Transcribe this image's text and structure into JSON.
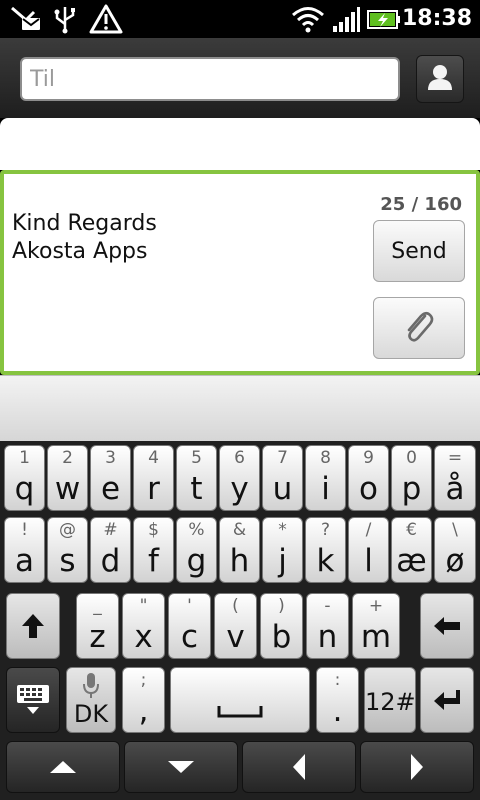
{
  "status_bar": {
    "time": "18:38",
    "icons": [
      "missed-sms-icon",
      "usb-icon",
      "warning-icon",
      "wifi-icon",
      "signal-icon",
      "battery-charging-icon"
    ]
  },
  "recipient": {
    "placeholder": "Til",
    "contact_button_icon": "contact-icon"
  },
  "compose": {
    "message": "Kind Regards\nAkosta Apps",
    "char_counter": "25 / 160",
    "send_label": "Send",
    "attach_icon": "paperclip-icon",
    "accent_color": "#86c440"
  },
  "keyboard": {
    "row1": [
      {
        "hint": "1",
        "main": "q"
      },
      {
        "hint": "2",
        "main": "w"
      },
      {
        "hint": "3",
        "main": "e"
      },
      {
        "hint": "4",
        "main": "r"
      },
      {
        "hint": "5",
        "main": "t"
      },
      {
        "hint": "6",
        "main": "y"
      },
      {
        "hint": "7",
        "main": "u"
      },
      {
        "hint": "8",
        "main": "i"
      },
      {
        "hint": "9",
        "main": "o"
      },
      {
        "hint": "0",
        "main": "p"
      },
      {
        "hint": "=",
        "main": "å"
      }
    ],
    "row2": [
      {
        "hint": "!",
        "main": "a"
      },
      {
        "hint": "@",
        "main": "s"
      },
      {
        "hint": "#",
        "main": "d"
      },
      {
        "hint": "$",
        "main": "f"
      },
      {
        "hint": "%",
        "main": "g"
      },
      {
        "hint": "&",
        "main": "h"
      },
      {
        "hint": "*",
        "main": "j"
      },
      {
        "hint": "?",
        "main": "k"
      },
      {
        "hint": "/",
        "main": "l"
      },
      {
        "hint": "€",
        "main": "æ"
      },
      {
        "hint": "\\",
        "main": "ø"
      }
    ],
    "row3": [
      {
        "hint": "_",
        "main": "z"
      },
      {
        "hint": "\"",
        "main": "x"
      },
      {
        "hint": "'",
        "main": "c"
      },
      {
        "hint": "(",
        "main": "v"
      },
      {
        "hint": ")",
        "main": "b"
      },
      {
        "hint": "-",
        "main": "n"
      },
      {
        "hint": "+",
        "main": "m"
      }
    ],
    "language_label": "DK",
    "comma_hint": ";",
    "comma_main": ",",
    "period_hint": ":",
    "period_main": ".",
    "symbols_label": "12#"
  }
}
